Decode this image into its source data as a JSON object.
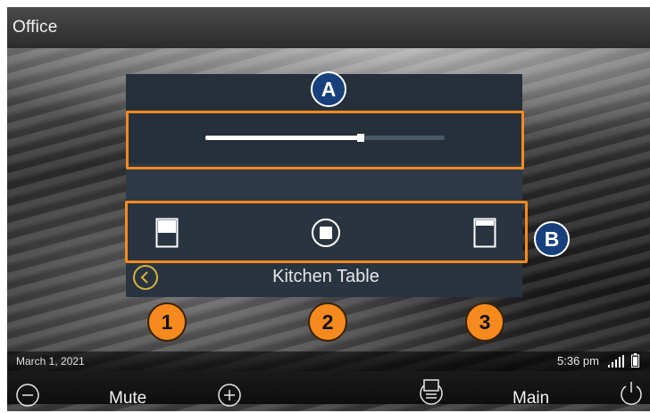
{
  "window": {
    "title": "Office"
  },
  "panel": {
    "zone_name": "Kitchen Table",
    "slider": {
      "level_percent": 65
    }
  },
  "annotations": {
    "letters": [
      "A",
      "B"
    ],
    "numbers": [
      "1",
      "2",
      "3"
    ],
    "highlight_color": "#f68a1e",
    "letter_badge_color": "#17407c"
  },
  "status_bar": {
    "date": "March 1, 2021",
    "time": "5:36 pm"
  },
  "bottom_bar": {
    "mute_label": "Mute",
    "main_label": "Main"
  },
  "icons": {
    "shade_open": "shade-open-icon",
    "stop": "stop-icon",
    "shade_close": "shade-close-icon",
    "back": "back-icon",
    "volume_down": "minus-circle-icon",
    "volume_up": "plus-circle-icon",
    "source": "source-icon",
    "power": "power-icon",
    "signal": "signal-icon",
    "battery": "battery-icon"
  },
  "colors": {
    "panel": "#2b3541",
    "accent_orange": "#f68a1e",
    "back_icon": "#d4b23a"
  }
}
